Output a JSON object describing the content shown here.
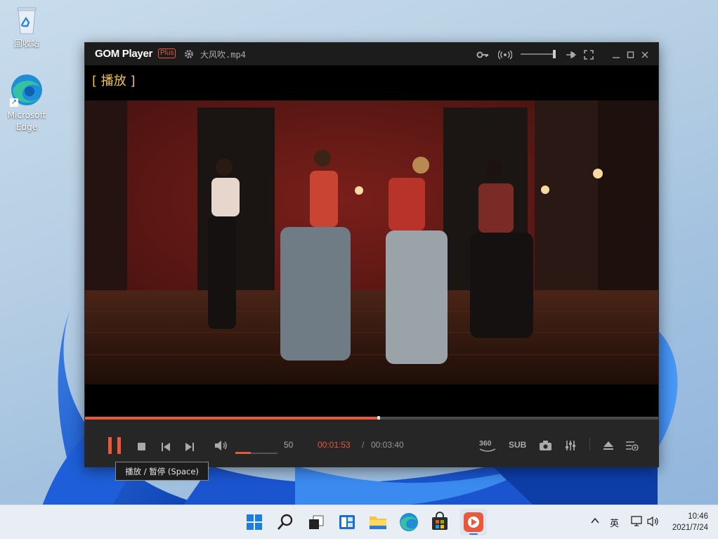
{
  "desktop": {
    "icons": [
      {
        "label": "回收站",
        "icon": "recycle-bin-icon"
      },
      {
        "label": "Microsoft Edge",
        "icon": "edge-icon"
      }
    ]
  },
  "player": {
    "logo": "GOM Player",
    "badge": "Plus",
    "file_name": "大风吹.mp4",
    "osd_text": "[ 播放 ]",
    "volume_value": "50",
    "volume_level": 0.5,
    "progress_fraction": 0.513,
    "time_current": "00:01:53",
    "time_separator": "/",
    "time_total": "00:03:40",
    "btn_360": "360",
    "btn_sub": "SUB",
    "tooltip": "播放 / 暂停 (Space)",
    "accent_color": "#e9583b"
  },
  "taskbar": {
    "ime": "英",
    "time": "10:46",
    "date": "2021/7/24"
  }
}
